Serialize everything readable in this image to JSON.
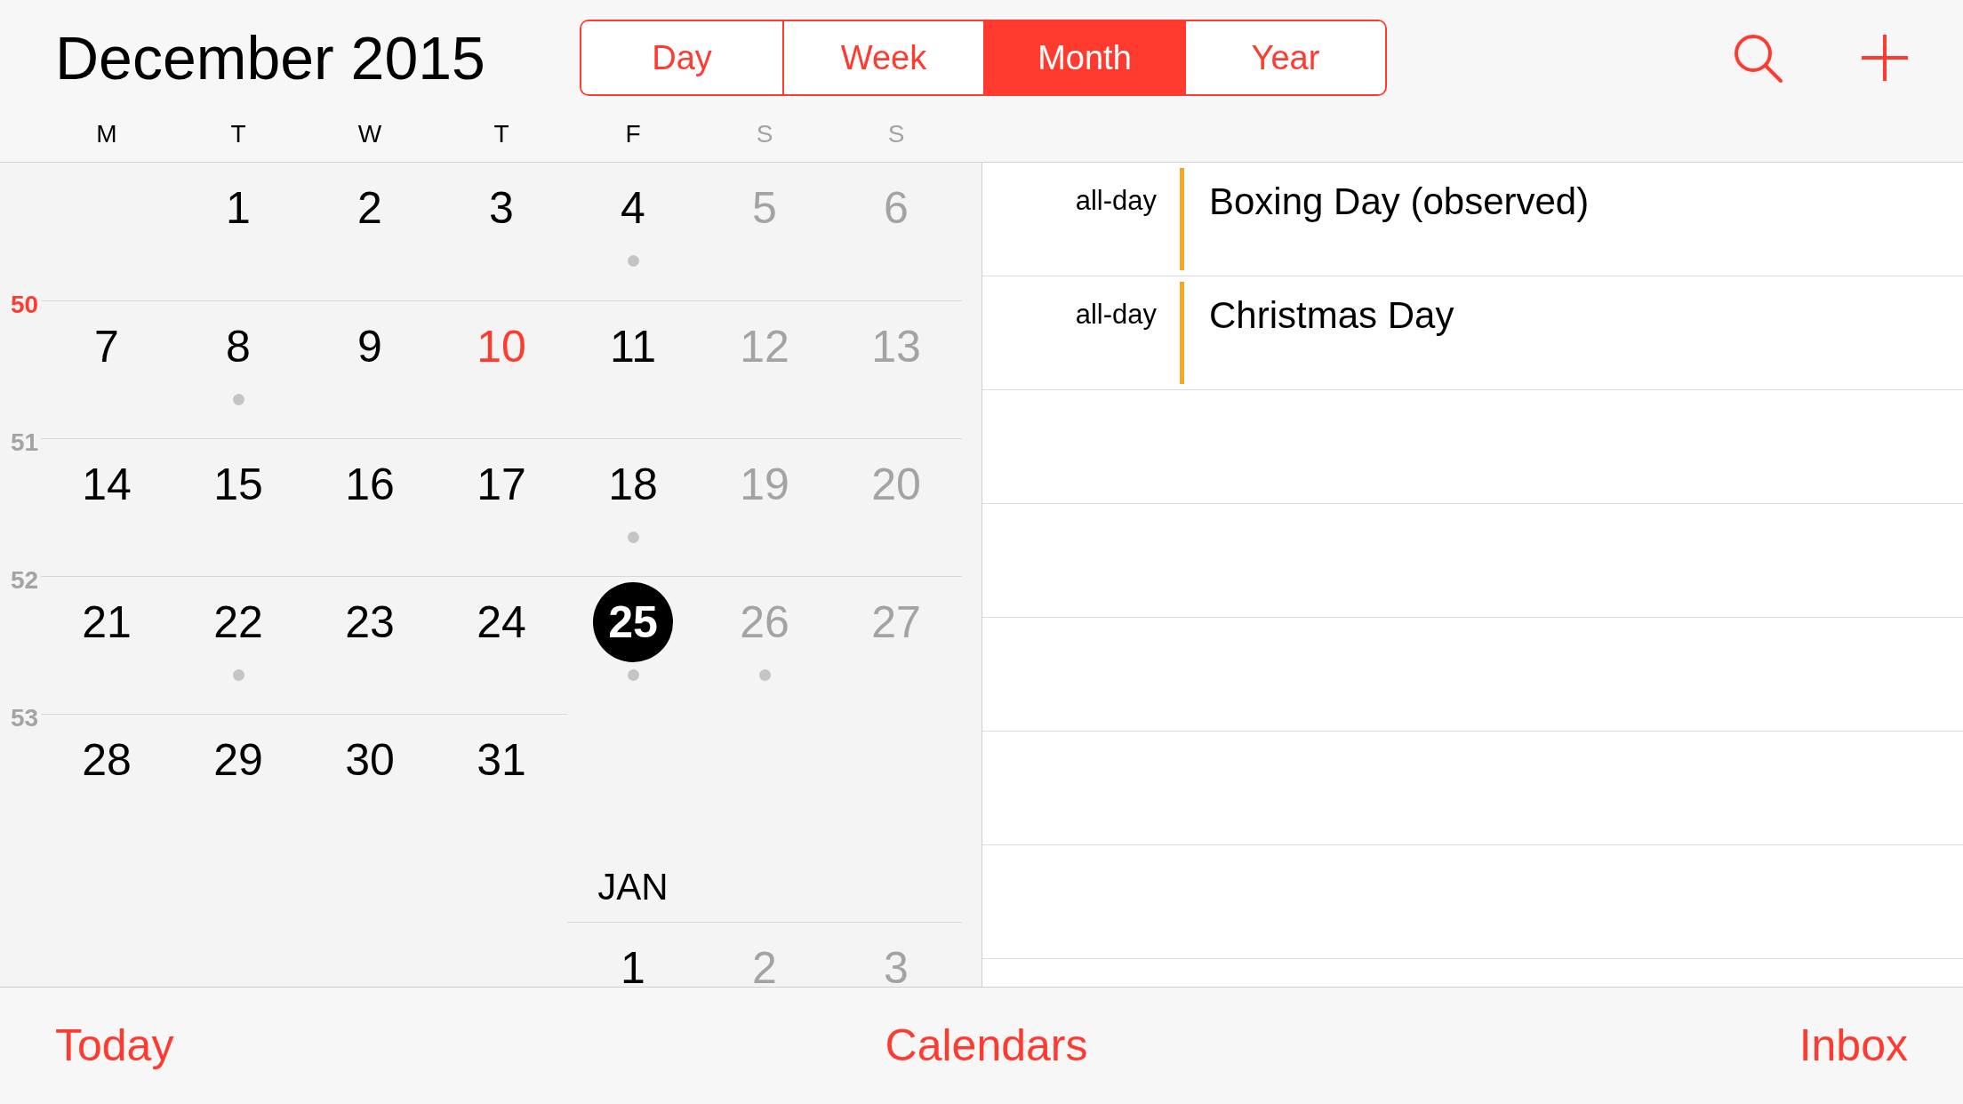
{
  "header": {
    "month": "December",
    "year": "2015",
    "view_tabs": [
      {
        "label": "Day",
        "selected": false
      },
      {
        "label": "Week",
        "selected": false
      },
      {
        "label": "Month",
        "selected": true
      },
      {
        "label": "Year",
        "selected": false
      }
    ]
  },
  "weekdays": [
    {
      "label": "M",
      "weekend": false
    },
    {
      "label": "T",
      "weekend": false
    },
    {
      "label": "W",
      "weekend": false
    },
    {
      "label": "T",
      "weekend": false
    },
    {
      "label": "F",
      "weekend": false
    },
    {
      "label": "S",
      "weekend": true
    },
    {
      "label": "S",
      "weekend": true
    }
  ],
  "weeks": [
    {
      "days": [
        {
          "kind": "blank"
        },
        {
          "kind": "day",
          "day": "1",
          "dot": false
        },
        {
          "kind": "day",
          "day": "2",
          "dot": false
        },
        {
          "kind": "day",
          "day": "3",
          "dot": false
        },
        {
          "kind": "day",
          "day": "4",
          "dot": true
        },
        {
          "kind": "weekend",
          "day": "5",
          "dot": false
        },
        {
          "kind": "weekend",
          "day": "6",
          "dot": false
        }
      ]
    },
    {
      "number": "50",
      "current": true,
      "days": [
        {
          "kind": "day",
          "day": "7",
          "dot": false
        },
        {
          "kind": "day",
          "day": "8",
          "dot": true
        },
        {
          "kind": "day",
          "day": "9",
          "dot": false
        },
        {
          "kind": "today",
          "day": "10",
          "dot": false
        },
        {
          "kind": "day",
          "day": "11",
          "dot": false
        },
        {
          "kind": "weekend",
          "day": "12",
          "dot": false
        },
        {
          "kind": "weekend",
          "day": "13",
          "dot": false
        }
      ]
    },
    {
      "number": "51",
      "current": false,
      "days": [
        {
          "kind": "day",
          "day": "14",
          "dot": false
        },
        {
          "kind": "day",
          "day": "15",
          "dot": false
        },
        {
          "kind": "day",
          "day": "16",
          "dot": false
        },
        {
          "kind": "day",
          "day": "17",
          "dot": false
        },
        {
          "kind": "day",
          "day": "18",
          "dot": true
        },
        {
          "kind": "weekend",
          "day": "19",
          "dot": false
        },
        {
          "kind": "weekend",
          "day": "20",
          "dot": false
        }
      ]
    },
    {
      "number": "52",
      "current": false,
      "days": [
        {
          "kind": "day",
          "day": "21",
          "dot": false
        },
        {
          "kind": "day",
          "day": "22",
          "dot": true
        },
        {
          "kind": "day",
          "day": "23",
          "dot": false
        },
        {
          "kind": "day",
          "day": "24",
          "dot": false
        },
        {
          "kind": "selected",
          "day": "25",
          "dot": true
        },
        {
          "kind": "weekend",
          "day": "26",
          "dot": true
        },
        {
          "kind": "weekend",
          "day": "27",
          "dot": false
        }
      ]
    },
    {
      "number": "53",
      "current": false,
      "days": [
        {
          "kind": "day",
          "day": "28",
          "dot": false
        },
        {
          "kind": "day",
          "day": "29",
          "dot": false
        },
        {
          "kind": "day",
          "day": "30",
          "dot": false
        },
        {
          "kind": "day",
          "day": "31",
          "dot": false
        },
        {
          "kind": "blank"
        },
        {
          "kind": "blank"
        },
        {
          "kind": "blank"
        }
      ]
    }
  ],
  "next_month": {
    "label": "JAN",
    "days": [
      {
        "kind": "blank"
      },
      {
        "kind": "blank"
      },
      {
        "kind": "blank"
      },
      {
        "kind": "blank"
      },
      {
        "kind": "day",
        "day": "1",
        "dot": false
      },
      {
        "kind": "weekend",
        "day": "2",
        "dot": false
      },
      {
        "kind": "weekend",
        "day": "3",
        "dot": false
      }
    ]
  },
  "events": [
    {
      "time": "all-day",
      "title": "Boxing Day (observed)",
      "color": "#f5a623"
    },
    {
      "time": "all-day",
      "title": "Christmas Day",
      "color": "#f5a623"
    }
  ],
  "toolbar": [
    "Today",
    "Calendars",
    "Inbox"
  ]
}
